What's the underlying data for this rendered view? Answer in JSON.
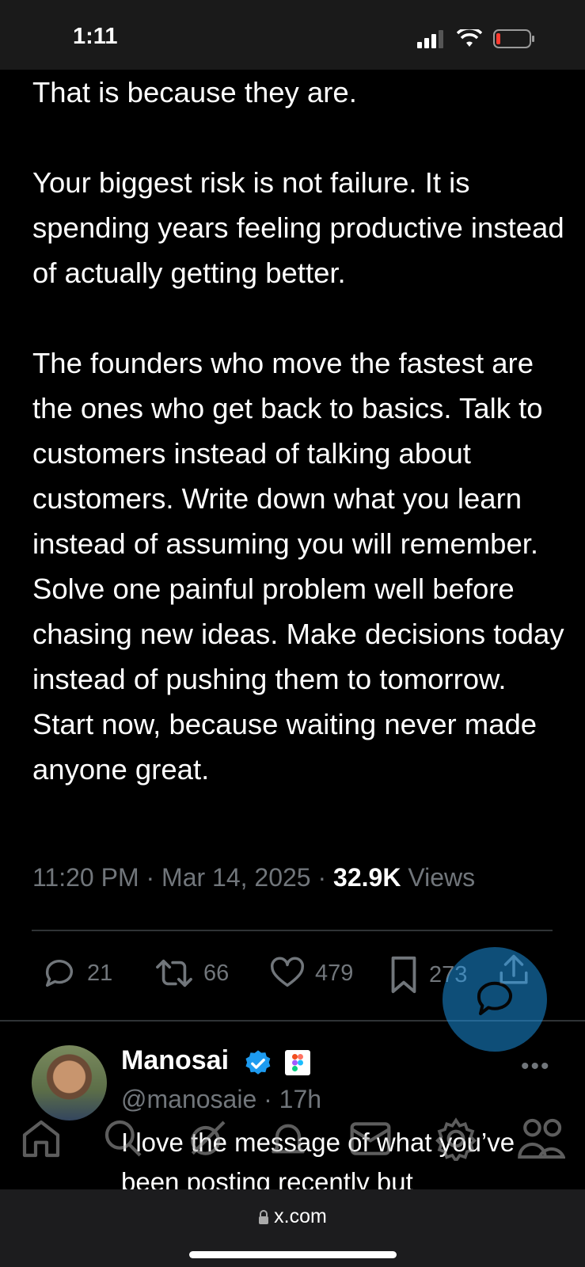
{
  "status_bar": {
    "time": "1:11"
  },
  "post": {
    "text": "That is because they are.\n\nYour biggest risk is not failure. It is spending years feeling productive instead of actually getting better.\n\nThe founders who move the fastest are the ones who get back to basics. Talk to customers instead of talking about customers. Write down what you learn instead of assuming you will remember. Solve one painful problem well before chasing new ideas. Make decisions today instead of pushing them to tomorrow. Start now, because waiting never made anyone great.",
    "timestamp": "11:20 PM · Mar 14, 2025 · ",
    "views_count": "32.9K",
    "views_label": " Views"
  },
  "actions": {
    "replies": "21",
    "reposts": "66",
    "likes": "479",
    "bookmarks": "273"
  },
  "reply": {
    "name": "Manosai",
    "handle": "@manosaie · 17h",
    "text": "I love the message of what you’ve been posting recently but"
  },
  "browser": {
    "url": "x.com"
  },
  "colors": {
    "accent": "#1d9bf0",
    "muted": "#71767b",
    "background": "#000000"
  },
  "icons": [
    "reply-icon",
    "repost-icon",
    "like-icon",
    "bookmark-icon",
    "share-icon",
    "compose-reply-icon",
    "home-icon",
    "search-icon",
    "grok-icon",
    "notifications-icon",
    "messages-icon",
    "communities-icon",
    "people-icon"
  ]
}
